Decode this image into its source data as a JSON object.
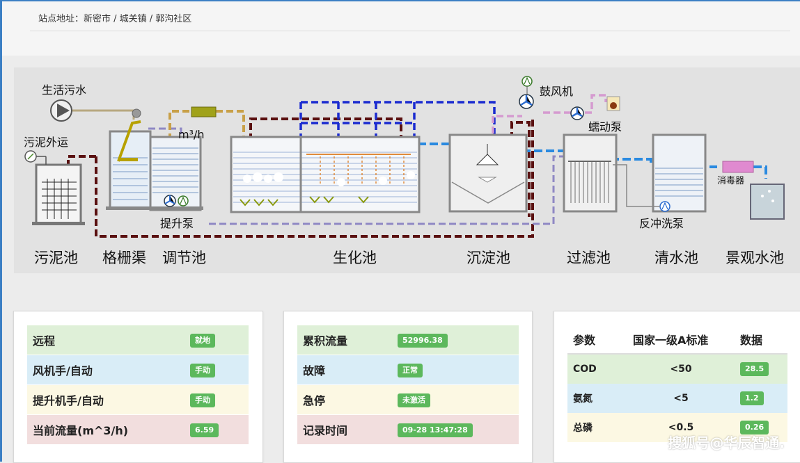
{
  "header": {
    "site_address": "站点地址：新密市 / 城关镇 / 郭沟社区"
  },
  "diagram": {
    "inlet_label": "生活污水",
    "sludge_out_label": "污泥外运",
    "flow_unit_label": "m³/h",
    "lift_pump_label": "提升泵",
    "blower_label": "鼓风机",
    "peristaltic_pump_label": "蠕动泵",
    "disinfector_label": "消毒器",
    "backwash_pump_label": "反冲洗泵",
    "stages": [
      "污泥池",
      "格栅渠",
      "调节池",
      "生化池",
      "沉淀池",
      "过滤池",
      "清水池",
      "景观水池"
    ]
  },
  "status_panel": {
    "rows": [
      {
        "label": "远程",
        "value": "就地"
      },
      {
        "label": "风机手/自动",
        "value": "手动"
      },
      {
        "label": "提升机手/自动",
        "value": "手动"
      },
      {
        "label": "当前流量(m^3/h)",
        "value": "6.59"
      }
    ]
  },
  "info_panel": {
    "rows": [
      {
        "label": "累积流量",
        "value": "52996.38"
      },
      {
        "label": "故障",
        "value": "正常"
      },
      {
        "label": "急停",
        "value": "未激活"
      },
      {
        "label": "记录时间",
        "value": "09-28 13:47:28"
      }
    ]
  },
  "param_panel": {
    "headers": [
      "参数",
      "国家一级A标准",
      "数据"
    ],
    "rows": [
      {
        "name": "COD",
        "standard": "<50",
        "value": "28.5"
      },
      {
        "name": "氨氮",
        "standard": "<5",
        "value": "1.2"
      },
      {
        "name": "总磷",
        "standard": "<0.5",
        "value": "0.26"
      }
    ]
  },
  "watermark": "搜狐号@华辰智通.",
  "colors": {
    "accent_blue": "#3b7fc4",
    "badge_green": "#5cb85c",
    "row_green": "#dff0d8",
    "row_blue": "#d9edf7",
    "row_yellow": "#fcf8e3",
    "row_red": "#f2dede"
  }
}
